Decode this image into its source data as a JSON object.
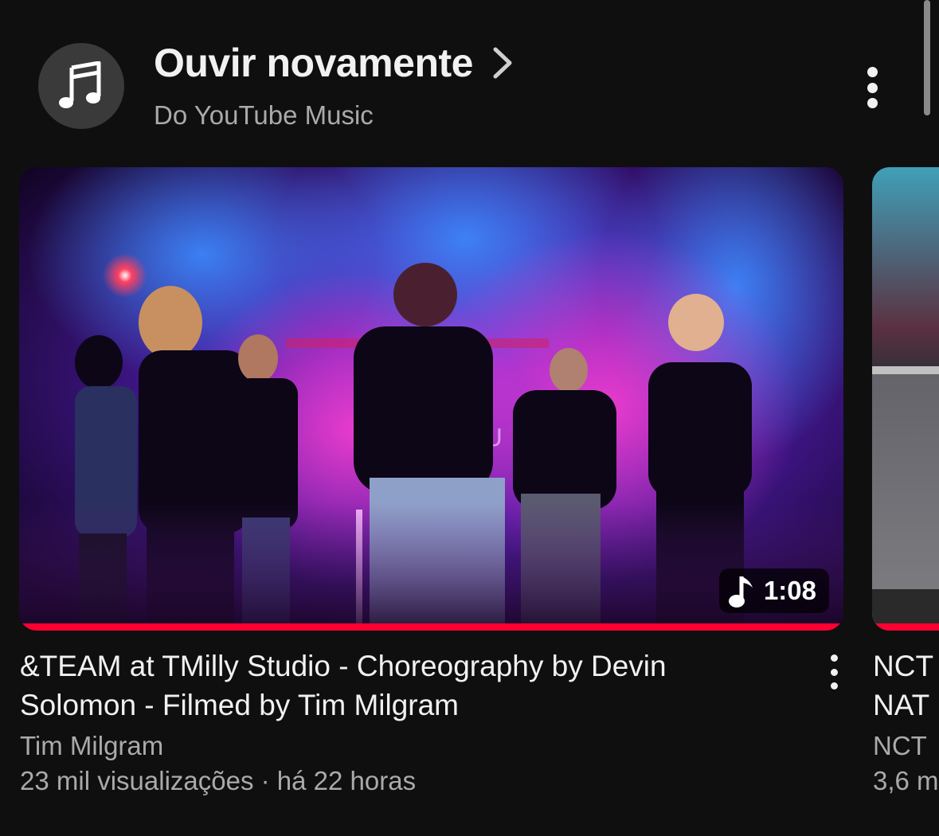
{
  "shelf": {
    "title": "Ouvir novamente",
    "subtitle": "Do YouTube Music",
    "icon": "music-note-icon"
  },
  "videos": [
    {
      "title": "&TEAM at TMilly Studio - Choreography by Devin Solomon - Filmed by Tim Milgram",
      "channel": "Tim Milgram",
      "meta": "23 mil visualizações · há 22 horas",
      "duration": "1:08",
      "badge_icon": "music-note-icon",
      "watched_fraction": 1.0,
      "thumbnail_text": "U"
    },
    {
      "title_line1": "NCT",
      "title_line2": "NAT",
      "channel": "NCT",
      "meta": "3,6 m"
    }
  ],
  "colors": {
    "background": "#0f0f0f",
    "progress": "#ff0033",
    "secondary_text": "#aaaaaa"
  }
}
